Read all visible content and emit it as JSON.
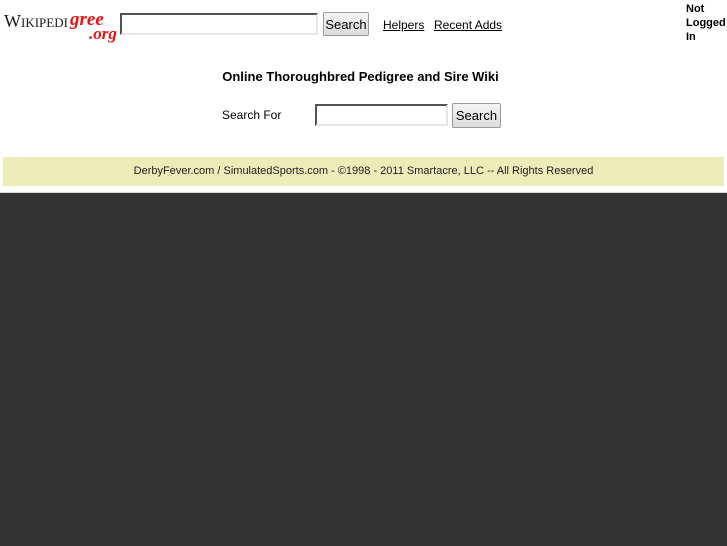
{
  "header": {
    "logo": {
      "part1": "Wikipedi",
      "part2": "gree",
      "part3": ".org"
    },
    "search": {
      "value": "",
      "placeholder": "",
      "button_label": "Search"
    },
    "links": [
      {
        "label": "Helpers"
      },
      {
        "label": "Recent Adds"
      }
    ],
    "login_status": "Not Logged In"
  },
  "main": {
    "title": "Online Thoroughbred Pedigree and Sire Wiki",
    "search": {
      "label": "Search For",
      "value": "",
      "placeholder": "",
      "button_label": "Search"
    }
  },
  "footer": {
    "text": "DerbyFever.com / SimulatedSports.com - ©1998 - 2011 Smartacre, LLC   -- All Rights Reserved",
    "band_color": "#ececb8"
  },
  "colors": {
    "logo_red": "#ee1111",
    "dark_panel": "#333333",
    "page_background": "#ffffff"
  }
}
